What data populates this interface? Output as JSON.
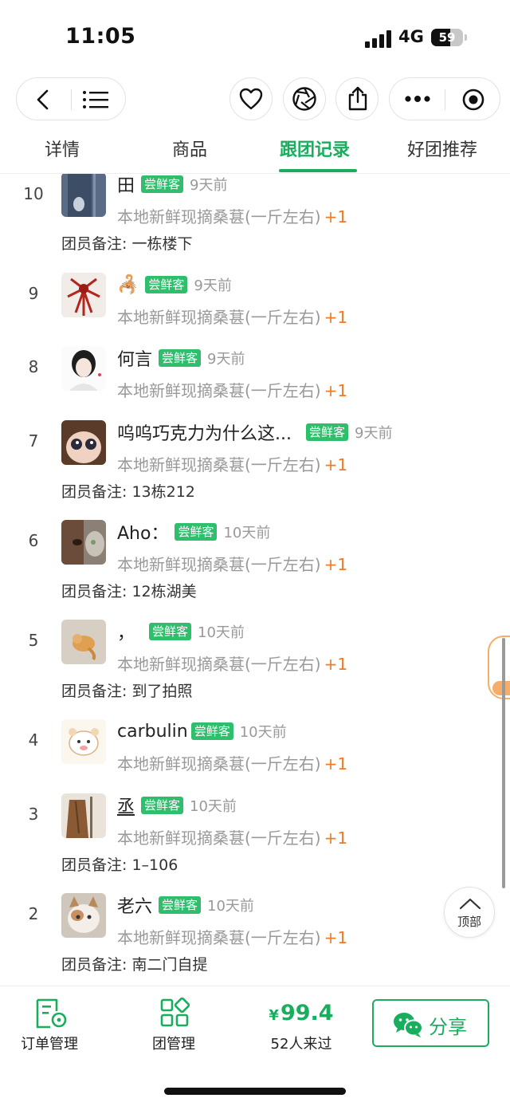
{
  "status_bar": {
    "time": "11:05",
    "network": "4G",
    "battery": "59",
    "battery_level": 0.59
  },
  "nav": {
    "icons": [
      "back-icon",
      "menu-icon",
      "heart-icon",
      "aperture-icon",
      "share-out-icon",
      "more-icon",
      "target-icon"
    ]
  },
  "tabs": [
    {
      "label": "详情",
      "active": false
    },
    {
      "label": "商品",
      "active": false
    },
    {
      "label": "跟团记录",
      "active": true
    },
    {
      "label": "好团推荐",
      "active": false
    }
  ],
  "records": [
    {
      "rank": "10",
      "name": "田",
      "badge": "尝鲜客",
      "ago": "9天前",
      "product": "本地新鲜现摘桑葚(一斤左右)",
      "qty": "+1",
      "note": "团员备注: 一栋楼下"
    },
    {
      "rank": "9",
      "name": "🦂",
      "badge": "尝鲜客",
      "ago": "9天前",
      "product": "本地新鲜现摘桑葚(一斤左右)",
      "qty": "+1",
      "note": ""
    },
    {
      "rank": "8",
      "name": "何言",
      "badge": "尝鲜客",
      "ago": "9天前",
      "product": "本地新鲜现摘桑葚(一斤左右)",
      "qty": "+1",
      "note": ""
    },
    {
      "rank": "7",
      "name": "呜呜巧克力为什么这...",
      "badge": "尝鲜客",
      "ago": "9天前",
      "product": "本地新鲜现摘桑葚(一斤左右)",
      "qty": "+1",
      "note": "团员备注: 13栋212"
    },
    {
      "rank": "6",
      "name": "Aho：",
      "badge": "尝鲜客",
      "ago": "10天前",
      "product": "本地新鲜现摘桑葚(一斤左右)",
      "qty": "+1",
      "note": "团员备注: 12栋湖美"
    },
    {
      "rank": "5",
      "name": "，",
      "badge": "尝鲜客",
      "ago": "10天前",
      "product": "本地新鲜现摘桑葚(一斤左右)",
      "qty": "+1",
      "note": "团员备注: 到了拍照"
    },
    {
      "rank": "4",
      "name": "carbulin",
      "badge": "尝鲜客",
      "ago": "10天前",
      "product": "本地新鲜现摘桑葚(一斤左右)",
      "qty": "+1",
      "note": ""
    },
    {
      "rank": "3",
      "name": "丞",
      "badge": "尝鲜客",
      "ago": "10天前",
      "product": "本地新鲜现摘桑葚(一斤左右)",
      "qty": "+1",
      "note": "团员备注: 1–106"
    },
    {
      "rank": "2",
      "name": "老六",
      "badge": "尝鲜客",
      "ago": "10天前",
      "product": "本地新鲜现摘桑葚(一斤左右)",
      "qty": "+1",
      "note": "团员备注: 南二门自提"
    }
  ],
  "back_to_top": "顶部",
  "bottom_bar": {
    "orders_label": "订单管理",
    "group_label": "团管理",
    "price_symbol": "¥",
    "price_value": "99.4",
    "visits": "52人来过",
    "share_label": "分享"
  },
  "colors": {
    "accent": "#1aad5e",
    "badge": "#2fbf6c",
    "qty": "#f07a26"
  }
}
